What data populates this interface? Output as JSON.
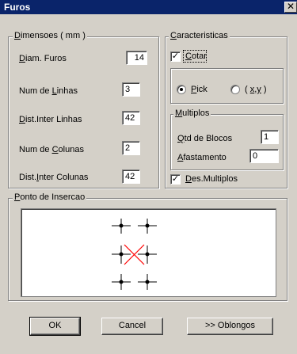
{
  "window": {
    "title": "Furos",
    "close_glyph": "✕"
  },
  "dimensoes": {
    "legend": "Dimensoes ( mm )",
    "diam_furos": {
      "label": "Diam. Furos",
      "value": "14"
    },
    "num_linhas": {
      "label": "Num de Linhas",
      "value": "3"
    },
    "dist_linhas": {
      "label": "Dist.Inter Linhas",
      "value": "42"
    },
    "num_colunas": {
      "label": "Num de Colunas",
      "value": "2"
    },
    "dist_colunas": {
      "label": "Dist.Inter Colunas",
      "value": "42"
    }
  },
  "caracteristicas": {
    "legend": "Caracteristicas",
    "cotar": {
      "label": "Cotar",
      "checked": true
    },
    "pick_label": "Pick",
    "xy_label": "( x,y )",
    "selected_mode": "Pick"
  },
  "multiplos": {
    "legend": "Multiplos",
    "qtd_blocos": {
      "label": "Qtd de Blocos",
      "value": "1"
    },
    "afastamento": {
      "label": "Afastamento",
      "value": "0"
    }
  },
  "des_multiplos": {
    "label": "Des.Multiplos",
    "checked": true
  },
  "ponto_insercao": {
    "legend": "Ponto de Insercao"
  },
  "buttons": {
    "ok": "OK",
    "cancel": "Cancel",
    "oblongos": ">> Oblongos"
  },
  "colors": {
    "title_bar": "#0a246a",
    "face": "#d4d0c8",
    "insert_marker": "#ff0000"
  }
}
